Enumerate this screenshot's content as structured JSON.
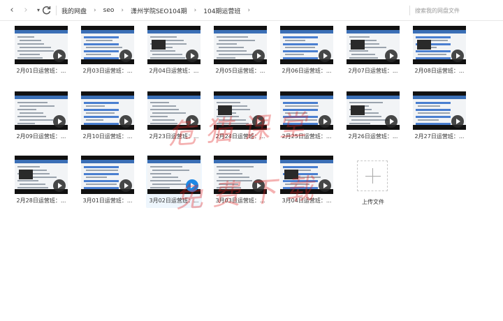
{
  "toolbar": {
    "back_icon": "chevron-left-icon",
    "forward_icon": "chevron-right-icon",
    "history_icon": "caret-down-icon",
    "refresh_icon": "refresh-icon",
    "search_placeholder": "搜索我的网盘文件"
  },
  "breadcrumb": [
    "我的网盘",
    "seo",
    "潇州学院SEO104期",
    "104期运营班"
  ],
  "files": [
    {
      "label": "2月01日运营班：..."
    },
    {
      "label": "2月03日运营班：..."
    },
    {
      "label": "2月04日运营班：..."
    },
    {
      "label": "2月05日运营班：..."
    },
    {
      "label": "2月06日运营班：..."
    },
    {
      "label": "2月07日运营班：..."
    },
    {
      "label": "2月08日运营班：..."
    },
    {
      "label": "2月09日运营班：..."
    },
    {
      "label": "2月10日运营班：..."
    },
    {
      "label": "2月23日运营班：..."
    },
    {
      "label": "2月24日运营班：..."
    },
    {
      "label": "2月25日运营班：..."
    },
    {
      "label": "2月26日运营班：..."
    },
    {
      "label": "2月27日运营班：..."
    },
    {
      "label": "2月28日运营班：..."
    },
    {
      "label": "3月01日运营班：..."
    },
    {
      "label": "3月02日运营班：...",
      "selected": true
    },
    {
      "label": "3月03日运营班：..."
    },
    {
      "label": "3月04日运营班：..."
    }
  ],
  "upload": {
    "label": "上传文件",
    "icon": "plus-icon"
  },
  "watermark": {
    "line1": "危 猫 课 堂",
    "line2": "免 费 下 载",
    "color": "#e02020"
  },
  "colors": {
    "accent": "#1e88e5",
    "selected_bg": "#eef6fd"
  }
}
